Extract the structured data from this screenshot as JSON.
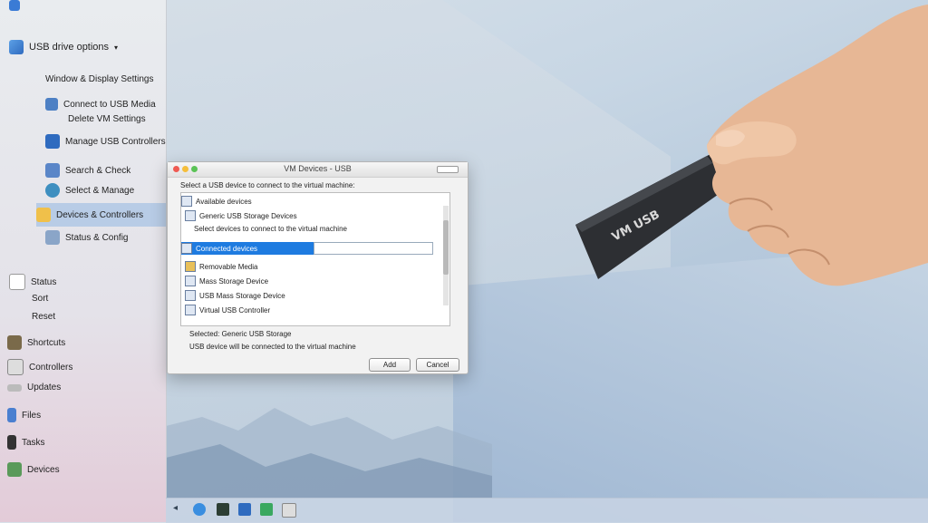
{
  "sidebar": {
    "title": "USB drive options",
    "items": [
      {
        "label": "Window & Display Settings"
      },
      {
        "label": "Connect to USB Media"
      },
      {
        "label": "Delete VM Settings"
      },
      {
        "label": "Manage USB Controllers"
      },
      {
        "label": "Search & Check"
      },
      {
        "label": "Select & Manage"
      },
      {
        "label": "Devices & Controllers"
      },
      {
        "label": "Status & Config"
      },
      {
        "label": "Status"
      },
      {
        "label": "Sort"
      },
      {
        "label": "Reset"
      },
      {
        "label": "Shortcuts"
      },
      {
        "label": "Controllers"
      },
      {
        "label": "Updates"
      },
      {
        "label": "Files"
      },
      {
        "label": "Tasks"
      },
      {
        "label": "Devices"
      }
    ]
  },
  "dialog": {
    "title": "VM Devices - USB",
    "header": "Select a USB device to connect to the virtual machine:",
    "list": [
      {
        "label": "Available devices"
      },
      {
        "label": "Generic USB Storage Devices"
      },
      {
        "label": "Select devices to connect to the virtual machine"
      },
      {
        "label": "Connected devices"
      },
      {
        "label": "Removable Media"
      },
      {
        "label": "Mass Storage Device"
      },
      {
        "label": "USB Mass Storage Device"
      },
      {
        "label": "Virtual USB Controller"
      }
    ],
    "info1": "Selected: Generic USB Storage",
    "info2": "USB device will be connected to the virtual machine",
    "ok_label": "Add",
    "cancel_label": "Cancel"
  },
  "usb_label": "VM USB"
}
